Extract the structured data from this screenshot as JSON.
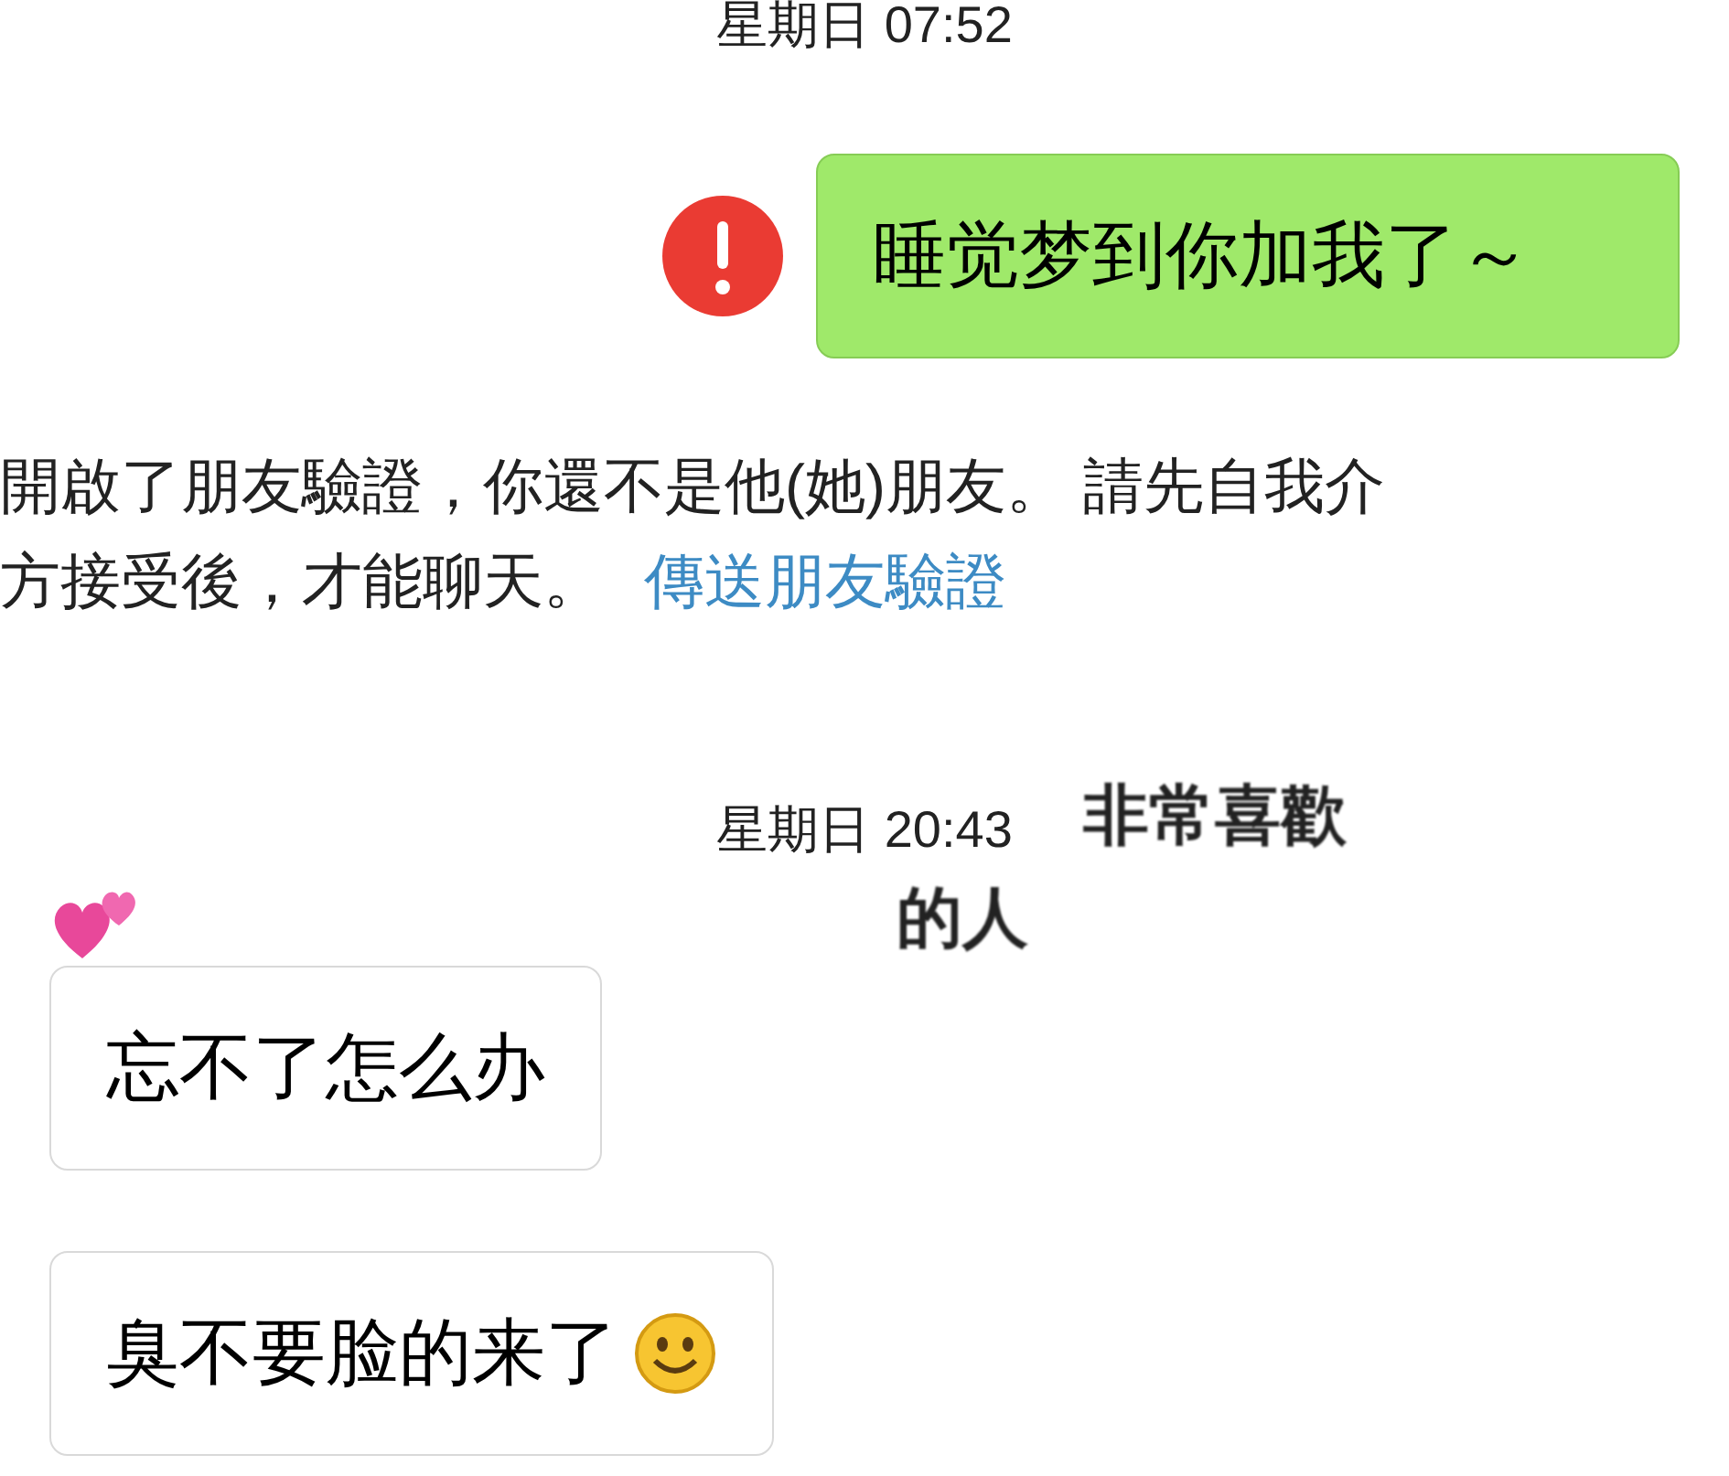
{
  "messages": [
    {
      "kind": "timestamp",
      "text": "星期日 07:52"
    },
    {
      "kind": "sent",
      "text": "睡觉梦到你加我了～",
      "failed": true
    },
    {
      "kind": "system",
      "lines": [
        "開啟了朋友驗證，你還不是他(她)朋友。 請先自我介",
        "方接受後，才能聊天。"
      ],
      "link": "傳送朋友驗證"
    },
    {
      "kind": "timestamp",
      "text": "星期日 20:43"
    },
    {
      "kind": "received",
      "text": "忘不了怎么办",
      "heart": true
    },
    {
      "kind": "received",
      "text": "臭不要脸的来了",
      "smiley": true
    }
  ],
  "overlay": {
    "lines": [
      "非常喜歡",
      "的人"
    ]
  }
}
